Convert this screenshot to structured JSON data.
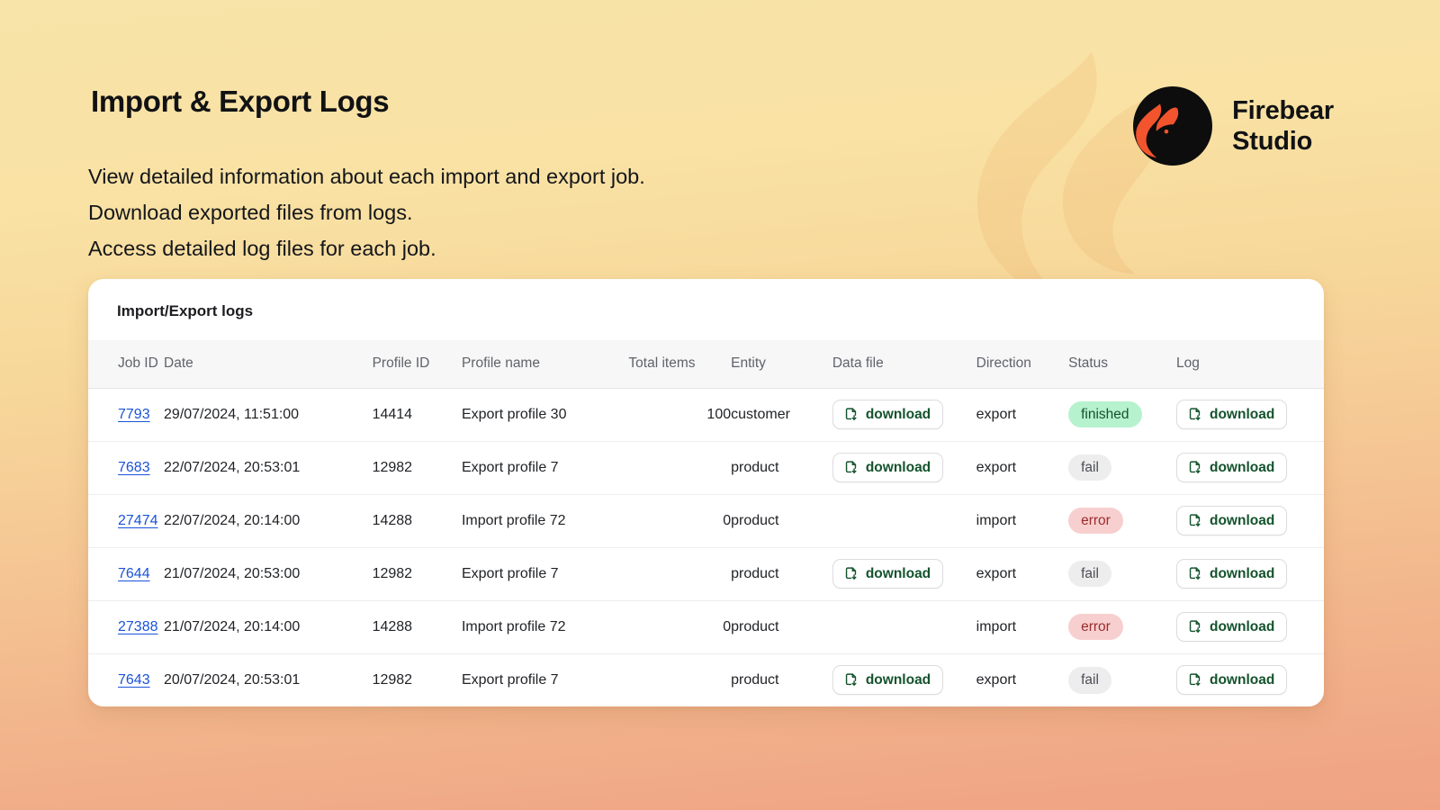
{
  "header": {
    "title": "Import & Export Logs",
    "intro_lines": [
      "View detailed information about each import and export job.",
      "Download exported files from logs.",
      "Access detailed log files for each job."
    ]
  },
  "brand": {
    "name_line1": "Firebear",
    "name_line2": "Studio",
    "logo_icon": "firebear-logo-icon",
    "logo_bg": "#0d0d0d",
    "logo_accent": "#f2542d"
  },
  "card": {
    "title": "Import/Export logs",
    "columns": [
      "Job ID",
      "Date",
      "Profile ID",
      "Profile name",
      "Total items",
      "Entity",
      "Data file",
      "Direction",
      "Status",
      "Log"
    ],
    "download_label": "download",
    "download_icon": "file-download-icon",
    "rows": [
      {
        "job_id": "7793",
        "date": "29/07/2024, 11:51:00",
        "profile_id": "14414",
        "profile_name": "Export profile 30",
        "total_items": "100",
        "entity": "customer",
        "data_file": "download",
        "direction": "export",
        "status": "finished",
        "status_kind": "finished",
        "log": "download"
      },
      {
        "job_id": "7683",
        "date": "22/07/2024, 20:53:01",
        "profile_id": "12982",
        "profile_name": "Export profile 7",
        "total_items": "",
        "entity": "product",
        "data_file": "download",
        "direction": "export",
        "status": "fail",
        "status_kind": "fail",
        "log": "download"
      },
      {
        "job_id": "27474",
        "date": "22/07/2024, 20:14:00",
        "profile_id": "14288",
        "profile_name": "Import profile 72",
        "total_items": "0",
        "entity": "product",
        "data_file": "",
        "direction": "import",
        "status": "error",
        "status_kind": "error",
        "log": "download"
      },
      {
        "job_id": "7644",
        "date": "21/07/2024, 20:53:00",
        "profile_id": "12982",
        "profile_name": "Export profile 7",
        "total_items": "",
        "entity": "product",
        "data_file": "download",
        "direction": "export",
        "status": "fail",
        "status_kind": "fail",
        "log": "download"
      },
      {
        "job_id": "27388",
        "date": "21/07/2024, 20:14:00",
        "profile_id": "14288",
        "profile_name": "Import profile 72",
        "total_items": "0",
        "entity": "product",
        "data_file": "",
        "direction": "import",
        "status": "error",
        "status_kind": "error",
        "log": "download"
      },
      {
        "job_id": "7643",
        "date": "20/07/2024, 20:53:01",
        "profile_id": "12982",
        "profile_name": "Export profile 7",
        "total_items": "",
        "entity": "product",
        "data_file": "download",
        "direction": "export",
        "status": "fail",
        "status_kind": "fail",
        "log": "download"
      }
    ]
  },
  "colors": {
    "background_top": "#f8e3a8",
    "background_bottom": "#efa383",
    "link": "#1a53d8",
    "download_text": "#14532d",
    "badge_finished_bg": "#b6f2ce",
    "badge_fail_bg": "#ededee",
    "badge_error_bg": "#f7cfcf"
  }
}
